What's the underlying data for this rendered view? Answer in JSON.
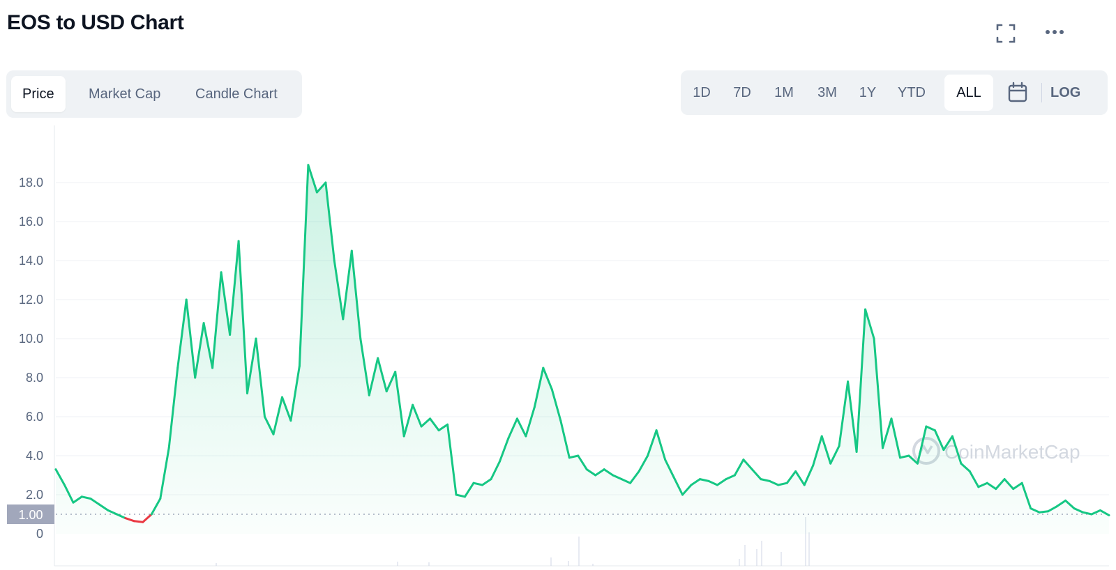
{
  "title": "EOS to USD Chart",
  "icons": {
    "fullscreen": "fullscreen-icon",
    "more": "more-dots-icon",
    "calendar": "calendar-icon",
    "watermark": "coinmarketcap-logo-icon"
  },
  "tabs": [
    "Price",
    "Market Cap",
    "Candle Chart"
  ],
  "active_tab": "Price",
  "ranges": [
    "1D",
    "7D",
    "1M",
    "3M",
    "1Y",
    "YTD",
    "ALL"
  ],
  "active_range": "ALL",
  "log_label": "LOG",
  "watermark": "CoinMarketCap",
  "colors": {
    "up": "#16c784",
    "down": "#ea3943",
    "grid": "#eff2f5",
    "text": "#58667e",
    "badge": "#a1a7bb"
  },
  "chart_data": {
    "type": "line",
    "title": "",
    "xlabel": "",
    "ylabel": "",
    "ylim": [
      0,
      20
    ],
    "y_ticks": [
      "0",
      "2.0",
      "4.0",
      "6.0",
      "8.0",
      "10.0",
      "12.0",
      "14.0",
      "16.0",
      "18.0"
    ],
    "baseline_value": 1.0,
    "baseline_label": "1.00",
    "series": [
      {
        "values": [
          3.3,
          2.5,
          1.6,
          1.9,
          1.8,
          1.5,
          1.2,
          1.0,
          0.8,
          0.65,
          0.6,
          1.0,
          1.8,
          4.4,
          8.5,
          12,
          8,
          10.8,
          8.5,
          13.4,
          10.2,
          15,
          7.2,
          10,
          6,
          5.1,
          7,
          5.8,
          8.6,
          18.9,
          17.5,
          18,
          14,
          11,
          14.5,
          10,
          7.1,
          9,
          7.3,
          8.3,
          5,
          6.6,
          5.5,
          5.9,
          5.3,
          5.6,
          2,
          1.9,
          2.6,
          2.5,
          2.8,
          3.7,
          4.9,
          5.9,
          5.0,
          6.5,
          8.5,
          7.4,
          5.8,
          3.9,
          4,
          3.3,
          3.0,
          3.3,
          3.0,
          2.8,
          2.6,
          3.2,
          4.0,
          5.3,
          3.8,
          2.9,
          2.0,
          2.5,
          2.8,
          2.7,
          2.5,
          2.8,
          3.0,
          3.8,
          3.3,
          2.8,
          2.7,
          2.5,
          2.6,
          3.2,
          2.5,
          3.5,
          5.0,
          3.6,
          4.5,
          7.8,
          4.2,
          11.5,
          10,
          4.4,
          5.9,
          3.9,
          4.0,
          3.6,
          5.5,
          5.3,
          4.3,
          5.0,
          3.6,
          3.2,
          2.4,
          2.6,
          2.3,
          2.8,
          2.3,
          2.6,
          1.3,
          1.1,
          1.15,
          1.4,
          1.7,
          1.3,
          1.1,
          1.0,
          1.2,
          0.95
        ]
      }
    ]
  }
}
